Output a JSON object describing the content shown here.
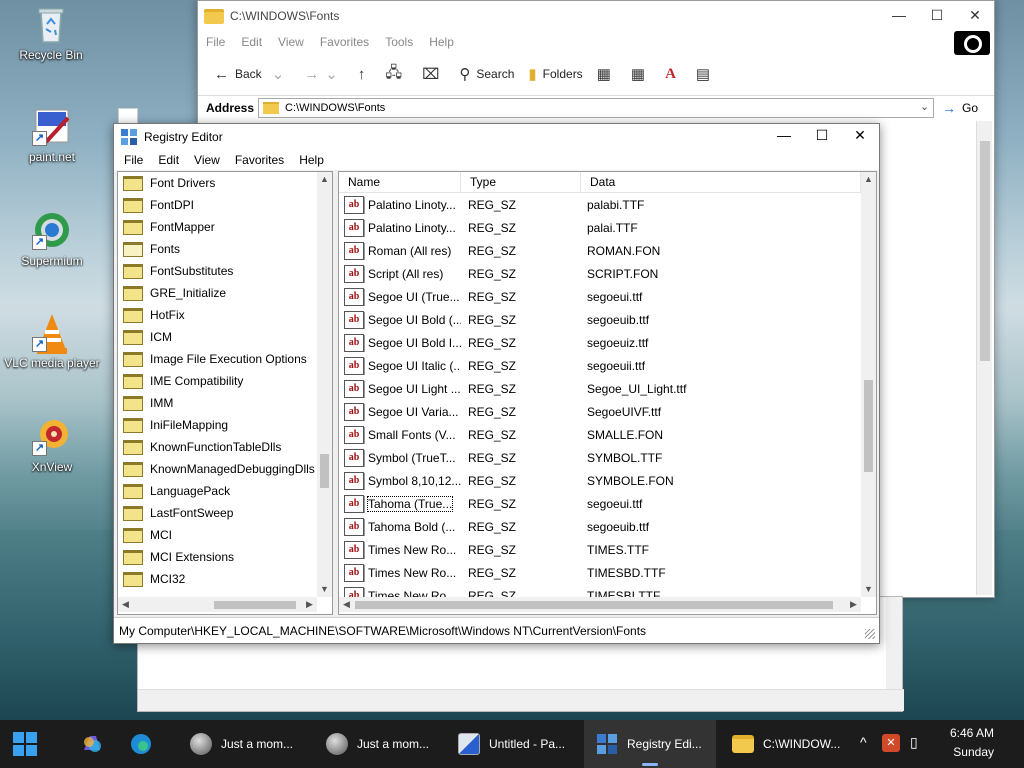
{
  "desktop": {
    "icons": [
      {
        "label": "Recycle Bin",
        "icon": "recycle-bin-icon"
      },
      {
        "label": "paint.net",
        "icon": "paintnet-icon"
      },
      {
        "label": "Supermium",
        "icon": "supermium-icon"
      },
      {
        "label": "VLC media player",
        "icon": "vlc-icon"
      },
      {
        "label": "XnView",
        "icon": "xnview-icon"
      }
    ]
  },
  "explorer": {
    "title": "C:\\WINDOWS\\Fonts",
    "menu": [
      "File",
      "Edit",
      "View",
      "Favorites",
      "Tools",
      "Help"
    ],
    "toolbar": {
      "back": "Back",
      "search": "Search",
      "folders": "Folders"
    },
    "address_label": "Address",
    "address_value": "C:\\WINDOWS\\Fonts",
    "go_label": "Go"
  },
  "regedit": {
    "title": "Registry Editor",
    "menu": [
      "File",
      "Edit",
      "View",
      "Favorites",
      "Help"
    ],
    "tree": [
      {
        "label": "Font Drivers"
      },
      {
        "label": "FontDPI"
      },
      {
        "label": "FontMapper"
      },
      {
        "label": "Fonts",
        "open": true
      },
      {
        "label": "FontSubstitutes"
      },
      {
        "label": "GRE_Initialize"
      },
      {
        "label": "HotFix"
      },
      {
        "label": "ICM"
      },
      {
        "label": "Image File Execution Options"
      },
      {
        "label": "IME Compatibility"
      },
      {
        "label": "IMM"
      },
      {
        "label": "IniFileMapping"
      },
      {
        "label": "KnownFunctionTableDlls"
      },
      {
        "label": "KnownManagedDebuggingDlls"
      },
      {
        "label": "LanguagePack"
      },
      {
        "label": "LastFontSweep"
      },
      {
        "label": "MCI"
      },
      {
        "label": "MCI Extensions"
      },
      {
        "label": "MCI32"
      }
    ],
    "columns": {
      "name": "Name",
      "type": "Type",
      "data": "Data"
    },
    "rows": [
      {
        "name": "Palatino Linoty...",
        "type": "REG_SZ",
        "data": "palabi.TTF"
      },
      {
        "name": "Palatino Linoty...",
        "type": "REG_SZ",
        "data": "palai.TTF"
      },
      {
        "name": "Roman (All res)",
        "type": "REG_SZ",
        "data": "ROMAN.FON"
      },
      {
        "name": "Script (All res)",
        "type": "REG_SZ",
        "data": "SCRIPT.FON"
      },
      {
        "name": "Segoe UI (True...",
        "type": "REG_SZ",
        "data": "segoeui.ttf"
      },
      {
        "name": "Segoe UI Bold (...",
        "type": "REG_SZ",
        "data": "segoeuib.ttf"
      },
      {
        "name": "Segoe UI Bold I...",
        "type": "REG_SZ",
        "data": "segoeuiz.ttf"
      },
      {
        "name": "Segoe UI Italic (...",
        "type": "REG_SZ",
        "data": "segoeuii.ttf"
      },
      {
        "name": "Segoe UI Light ...",
        "type": "REG_SZ",
        "data": "Segoe_UI_Light.ttf"
      },
      {
        "name": "Segoe UI Varia...",
        "type": "REG_SZ",
        "data": "SegoeUIVF.ttf"
      },
      {
        "name": "Small Fonts (V...",
        "type": "REG_SZ",
        "data": "SMALLE.FON"
      },
      {
        "name": "Symbol (TrueT...",
        "type": "REG_SZ",
        "data": "SYMBOL.TTF"
      },
      {
        "name": "Symbol 8,10,12...",
        "type": "REG_SZ",
        "data": "SYMBOLE.FON"
      },
      {
        "name": "Tahoma (True...",
        "type": "REG_SZ",
        "data": "segoeui.ttf",
        "selected": true
      },
      {
        "name": "Tahoma Bold (...",
        "type": "REG_SZ",
        "data": "segoeuib.ttf"
      },
      {
        "name": "Times New Ro...",
        "type": "REG_SZ",
        "data": "TIMES.TTF"
      },
      {
        "name": "Times New Ro...",
        "type": "REG_SZ",
        "data": "TIMESBD.TTF"
      },
      {
        "name": "Times New Ro...",
        "type": "REG_SZ",
        "data": "TIMESBI.TTF"
      }
    ],
    "status_path": "My Computer\\HKEY_LOCAL_MACHINE\\SOFTWARE\\Microsoft\\Windows NT\\CurrentVersion\\Fonts"
  },
  "taskbar": {
    "items": [
      {
        "label": "Just a mom...",
        "icon": "browser-icon"
      },
      {
        "label": "Just a mom...",
        "icon": "browser-icon"
      },
      {
        "label": "Untitled - Pa...",
        "icon": "paint-icon"
      },
      {
        "label": "Registry Edi...",
        "icon": "regedit-icon",
        "active": true
      },
      {
        "label": "C:\\WINDOW...",
        "icon": "folder-icon"
      }
    ],
    "time": "6:46 AM",
    "day": "Sunday"
  },
  "colors": {
    "taskbar_bg": "#1c1c1c",
    "accent": "#1a6fd0",
    "folder": "#f3e38a"
  }
}
